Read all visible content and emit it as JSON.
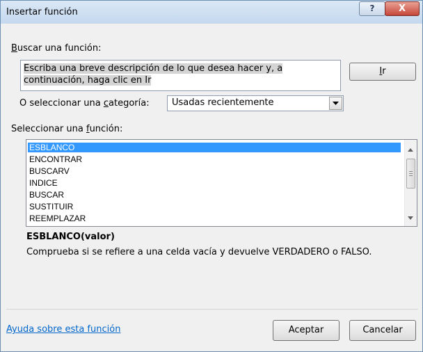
{
  "window": {
    "title": "Insertar función",
    "help_glyph": "?",
    "close_glyph": "X"
  },
  "search": {
    "label_prefix": "",
    "label_key": "B",
    "label_rest": "uscar una función:",
    "text_line1": "Escriba una breve descripción de lo que desea hacer y, a",
    "text_line2": "continuación, haga clic en Ir",
    "go_key": "I",
    "go_rest": "r"
  },
  "category": {
    "label_prefix": "O seleccionar una ",
    "label_key": "c",
    "label_rest": "ategoría:",
    "selected": "Usadas recientemente"
  },
  "functions": {
    "label_prefix": "Seleccionar una ",
    "label_key": "f",
    "label_rest": "unción:",
    "items": [
      "ESBLANCO",
      "ENCONTRAR",
      "BUSCARV",
      "INDICE",
      "BUSCAR",
      "SUSTITUIR",
      "REEMPLAZAR"
    ],
    "selected_index": 0
  },
  "details": {
    "signature": "ESBLANCO(valor)",
    "description": "Comprueba si se refiere a una celda vacía y devuelve VERDADERO o FALSO."
  },
  "footer": {
    "help_link": "Ayuda sobre esta función",
    "ok_label": "Aceptar",
    "cancel_label": "Cancelar"
  },
  "colors": {
    "selection": "#3399ff",
    "link": "#0066cc",
    "close_button": "#c5463a"
  }
}
